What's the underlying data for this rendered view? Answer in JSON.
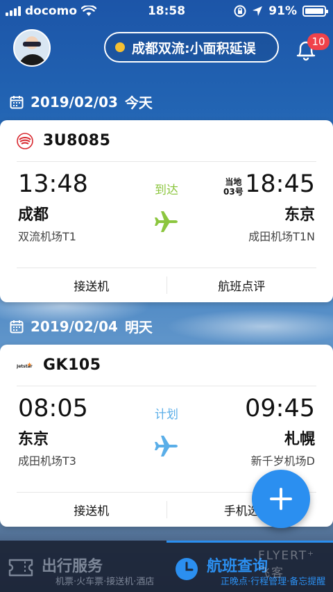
{
  "status_bar": {
    "carrier": "docomo",
    "time": "18:58",
    "battery": "91%"
  },
  "header": {
    "weather_alert": "成都双流:小面积延误",
    "notification_count": "10"
  },
  "trips": [
    {
      "date": "2019/02/03",
      "day_label": "今天",
      "flight_no": "3U8085",
      "status": "到达",
      "status_color": "#8cc63f",
      "dep_time": "13:48",
      "dep_city": "成都",
      "dep_airport": "双流机场T1",
      "arr_local_label": "当地",
      "arr_local_day": "03号",
      "arr_time": "18:45",
      "arr_city": "东京",
      "arr_airport": "成田机场T1N",
      "action_left": "接送机",
      "action_right": "航班点评"
    },
    {
      "date": "2019/02/04",
      "day_label": "明天",
      "flight_no": "GK105",
      "status": "计划",
      "status_color": "#5aaee8",
      "dep_time": "08:05",
      "dep_city": "东京",
      "dep_airport": "成田机场T3",
      "arr_time": "09:45",
      "arr_city": "札幌",
      "arr_airport": "新千岁机场D",
      "action_left": "接送机",
      "action_right": "手机选"
    }
  ],
  "tabs": [
    {
      "title": "出行服务",
      "subtitle": "机票·火车票·接送机·酒店",
      "active": false
    },
    {
      "title": "航班查询",
      "subtitle": "正晚点·行程管理·备忘提醒",
      "active": true
    }
  ],
  "watermark": "FLYERT⁺ 飞客",
  "colors": {
    "accent": "#2b8ff0",
    "badge": "#f0424a",
    "arrived": "#8cc63f",
    "planned": "#5aaee8"
  }
}
